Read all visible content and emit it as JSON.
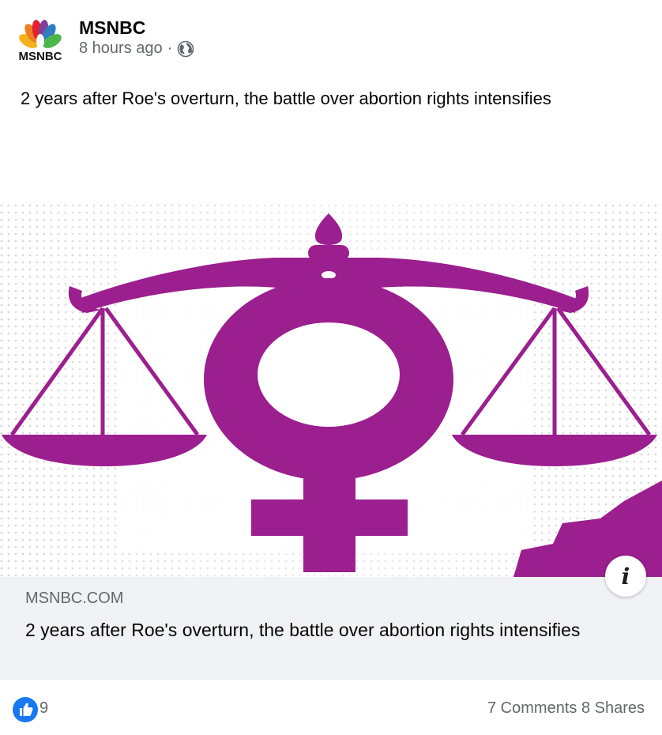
{
  "post": {
    "author": "MSNBC",
    "logo_text": "MSNBC",
    "time": "8 hours ago",
    "separator": "·",
    "audience_icon": "globe-icon",
    "caption": "2 years after Roe's overturn, the battle over abortion rights intensifies"
  },
  "link_preview": {
    "domain": "MSNBC.COM",
    "title": "2 years after Roe's overturn, the battle over abortion rights intensifies",
    "info_icon": "i"
  },
  "reactions": {
    "icon": "thumbs-up-icon",
    "count": "9",
    "comments": "7 Comments",
    "shares": "8 Shares"
  },
  "colors": {
    "accent": "#1877f2",
    "purple": "#9b1f8e",
    "muted": "#65676b"
  }
}
